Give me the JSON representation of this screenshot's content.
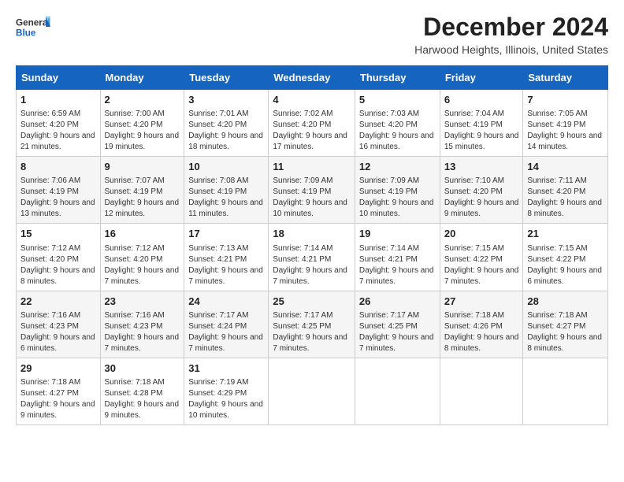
{
  "logo": {
    "general": "General",
    "blue": "Blue"
  },
  "title": {
    "month_year": "December 2024",
    "location": "Harwood Heights, Illinois, United States"
  },
  "weekdays": [
    "Sunday",
    "Monday",
    "Tuesday",
    "Wednesday",
    "Thursday",
    "Friday",
    "Saturday"
  ],
  "weeks": [
    [
      {
        "day": "1",
        "sunrise": "6:59 AM",
        "sunset": "4:20 PM",
        "daylight": "9 hours and 21 minutes."
      },
      {
        "day": "2",
        "sunrise": "7:00 AM",
        "sunset": "4:20 PM",
        "daylight": "9 hours and 19 minutes."
      },
      {
        "day": "3",
        "sunrise": "7:01 AM",
        "sunset": "4:20 PM",
        "daylight": "9 hours and 18 minutes."
      },
      {
        "day": "4",
        "sunrise": "7:02 AM",
        "sunset": "4:20 PM",
        "daylight": "9 hours and 17 minutes."
      },
      {
        "day": "5",
        "sunrise": "7:03 AM",
        "sunset": "4:20 PM",
        "daylight": "9 hours and 16 minutes."
      },
      {
        "day": "6",
        "sunrise": "7:04 AM",
        "sunset": "4:19 PM",
        "daylight": "9 hours and 15 minutes."
      },
      {
        "day": "7",
        "sunrise": "7:05 AM",
        "sunset": "4:19 PM",
        "daylight": "9 hours and 14 minutes."
      }
    ],
    [
      {
        "day": "8",
        "sunrise": "7:06 AM",
        "sunset": "4:19 PM",
        "daylight": "9 hours and 13 minutes."
      },
      {
        "day": "9",
        "sunrise": "7:07 AM",
        "sunset": "4:19 PM",
        "daylight": "9 hours and 12 minutes."
      },
      {
        "day": "10",
        "sunrise": "7:08 AM",
        "sunset": "4:19 PM",
        "daylight": "9 hours and 11 minutes."
      },
      {
        "day": "11",
        "sunrise": "7:09 AM",
        "sunset": "4:19 PM",
        "daylight": "9 hours and 10 minutes."
      },
      {
        "day": "12",
        "sunrise": "7:09 AM",
        "sunset": "4:19 PM",
        "daylight": "9 hours and 10 minutes."
      },
      {
        "day": "13",
        "sunrise": "7:10 AM",
        "sunset": "4:20 PM",
        "daylight": "9 hours and 9 minutes."
      },
      {
        "day": "14",
        "sunrise": "7:11 AM",
        "sunset": "4:20 PM",
        "daylight": "9 hours and 8 minutes."
      }
    ],
    [
      {
        "day": "15",
        "sunrise": "7:12 AM",
        "sunset": "4:20 PM",
        "daylight": "9 hours and 8 minutes."
      },
      {
        "day": "16",
        "sunrise": "7:12 AM",
        "sunset": "4:20 PM",
        "daylight": "9 hours and 7 minutes."
      },
      {
        "day": "17",
        "sunrise": "7:13 AM",
        "sunset": "4:21 PM",
        "daylight": "9 hours and 7 minutes."
      },
      {
        "day": "18",
        "sunrise": "7:14 AM",
        "sunset": "4:21 PM",
        "daylight": "9 hours and 7 minutes."
      },
      {
        "day": "19",
        "sunrise": "7:14 AM",
        "sunset": "4:21 PM",
        "daylight": "9 hours and 7 minutes."
      },
      {
        "day": "20",
        "sunrise": "7:15 AM",
        "sunset": "4:22 PM",
        "daylight": "9 hours and 7 minutes."
      },
      {
        "day": "21",
        "sunrise": "7:15 AM",
        "sunset": "4:22 PM",
        "daylight": "9 hours and 6 minutes."
      }
    ],
    [
      {
        "day": "22",
        "sunrise": "7:16 AM",
        "sunset": "4:23 PM",
        "daylight": "9 hours and 6 minutes."
      },
      {
        "day": "23",
        "sunrise": "7:16 AM",
        "sunset": "4:23 PM",
        "daylight": "9 hours and 7 minutes."
      },
      {
        "day": "24",
        "sunrise": "7:17 AM",
        "sunset": "4:24 PM",
        "daylight": "9 hours and 7 minutes."
      },
      {
        "day": "25",
        "sunrise": "7:17 AM",
        "sunset": "4:25 PM",
        "daylight": "9 hours and 7 minutes."
      },
      {
        "day": "26",
        "sunrise": "7:17 AM",
        "sunset": "4:25 PM",
        "daylight": "9 hours and 7 minutes."
      },
      {
        "day": "27",
        "sunrise": "7:18 AM",
        "sunset": "4:26 PM",
        "daylight": "9 hours and 8 minutes."
      },
      {
        "day": "28",
        "sunrise": "7:18 AM",
        "sunset": "4:27 PM",
        "daylight": "9 hours and 8 minutes."
      }
    ],
    [
      {
        "day": "29",
        "sunrise": "7:18 AM",
        "sunset": "4:27 PM",
        "daylight": "9 hours and 9 minutes."
      },
      {
        "day": "30",
        "sunrise": "7:18 AM",
        "sunset": "4:28 PM",
        "daylight": "9 hours and 9 minutes."
      },
      {
        "day": "31",
        "sunrise": "7:19 AM",
        "sunset": "4:29 PM",
        "daylight": "9 hours and 10 minutes."
      },
      null,
      null,
      null,
      null
    ]
  ],
  "labels": {
    "sunrise": "Sunrise:",
    "sunset": "Sunset:",
    "daylight": "Daylight:"
  }
}
